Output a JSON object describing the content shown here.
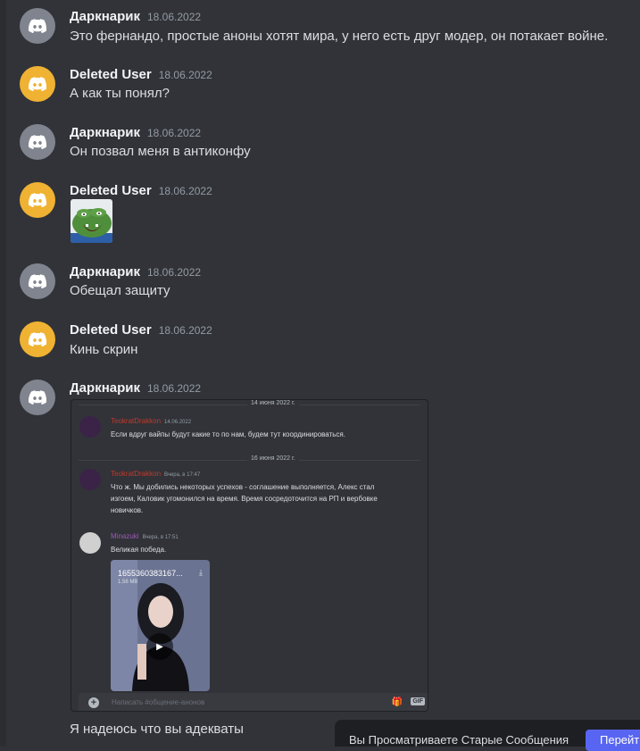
{
  "messages": [
    {
      "author": "Даркнарик",
      "date": "18.06.2022",
      "text": "Это фернандо, простые аноны хотят мира, у него есть друг модер, он потакает войне."
    },
    {
      "author": "Deleted User",
      "date": "18.06.2022",
      "text": "А как ты понял?"
    },
    {
      "author": "Даркнарик",
      "date": "18.06.2022",
      "text": "Он позвал меня в антиконфу"
    },
    {
      "author": "Deleted User",
      "date": "18.06.2022",
      "text": ""
    },
    {
      "author": "Даркнарик",
      "date": "18.06.2022",
      "text": "Обещал защиту"
    },
    {
      "author": "Deleted User",
      "date": "18.06.2022",
      "text": "Кинь скрин"
    },
    {
      "author": "Даркнарик",
      "date": "18.06.2022",
      "text": "Я надеюсь что вы адекваты"
    }
  ],
  "screenshot": {
    "divider1": "14 июня 2022 г.",
    "divider2": "16 июня 2022 г.",
    "posts": [
      {
        "author": "TeokratDrakkon",
        "time": "14.06.2022",
        "lines": [
          "Если вдруг вайпы будут какие то по нам, будем тут координироваться."
        ]
      },
      {
        "author": "TeokratDrakkon",
        "time": "Вчера, в 17:47",
        "lines": [
          "Что ж. Мы добились некоторых успехов - соглашение выполняется, Алекс стал",
          "изгоем, Каловик угомонился на время. Время сосредоточится на РП и вербовке",
          "новичков."
        ]
      },
      {
        "author": "Minazuki",
        "time": "Вчера, в 17:51",
        "lines": [
          "Великая победа."
        ]
      }
    ],
    "video": {
      "filename": "1655360383167...",
      "size": "1.56 MB"
    },
    "chat_placeholder": "Написать #общение-анонов",
    "gif_label": "GIF"
  },
  "banner": {
    "text": "Вы Просматриваете Старые Сообщения",
    "jump_label": "Перейти"
  },
  "colors": {
    "background": "#313338",
    "accent": "#5865f2",
    "avatar_grey": "#80848e",
    "avatar_yellow": "#f0b232",
    "red_name": "#c0392b",
    "purple_name": "#9b59b6"
  },
  "icons": {
    "avatar": "discord-logo-icon",
    "attach": "plus-circle-icon",
    "gift": "gift-icon",
    "download": "download-icon",
    "play": "play-icon"
  }
}
